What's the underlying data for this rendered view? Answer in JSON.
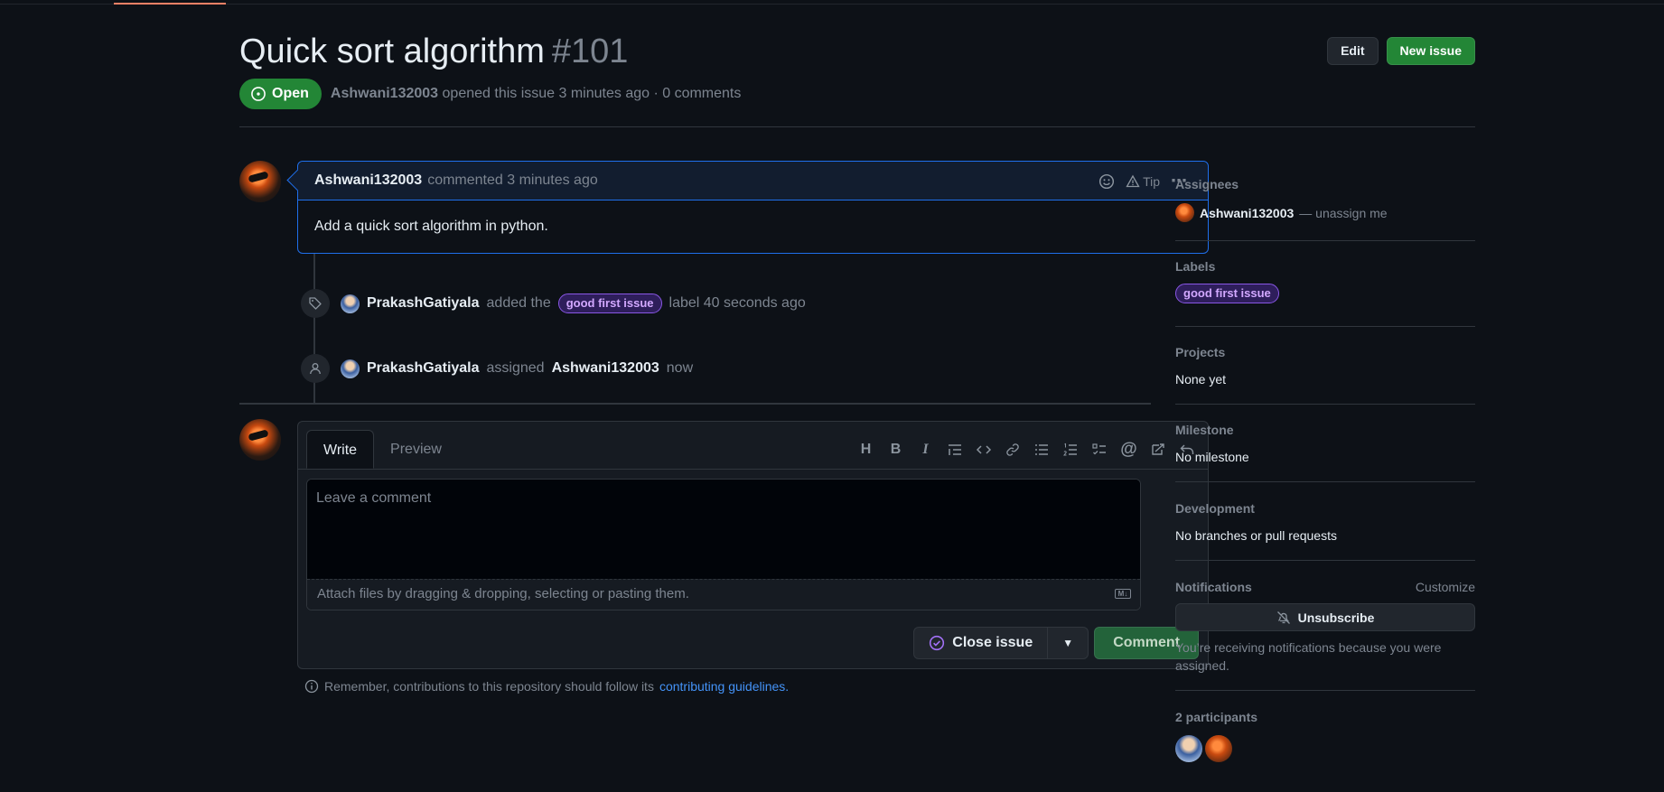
{
  "issue": {
    "title": "Quick sort algorithm",
    "number": "#101",
    "state": "Open",
    "author": "Ashwani132003",
    "opened_text": "opened this issue 3 minutes ago · 0 comments"
  },
  "header": {
    "edit_label": "Edit",
    "new_issue_label": "New issue"
  },
  "comment": {
    "author": "Ashwani132003",
    "time": "commented 3 minutes ago",
    "tip_label": "Tip",
    "body": "Add a quick sort algorithm in python."
  },
  "events": [
    {
      "actor": "PrakashGatiyala",
      "action": "added the",
      "label": "good first issue",
      "suffix": "label 40 seconds ago"
    },
    {
      "actor": "PrakashGatiyala",
      "action": "assigned",
      "target": "Ashwani132003",
      "suffix": "now"
    }
  ],
  "composer": {
    "tab_write": "Write",
    "tab_preview": "Preview",
    "toolbar": [
      "H",
      "B",
      "I",
      "quote",
      "code",
      "link",
      "bullet-list",
      "numbered-list",
      "task-list",
      "@",
      "cross-reference",
      "undo"
    ],
    "placeholder": "Leave a comment",
    "attach_text": "Attach files by dragging & dropping, selecting or pasting them.",
    "md_badge": "M↓",
    "close_label": "Close issue",
    "comment_label": "Comment"
  },
  "reminder": {
    "text": "Remember, contributions to this repository should follow its",
    "link": "contributing guidelines."
  },
  "sidebar": {
    "assignees_title": "Assignees",
    "assignee_name": "Ashwani132003",
    "unassign_text": "— unassign me",
    "labels_title": "Labels",
    "label": "good first issue",
    "projects_title": "Projects",
    "projects_value": "None yet",
    "milestone_title": "Milestone",
    "milestone_value": "No milestone",
    "development_title": "Development",
    "development_value": "No branches or pull requests",
    "notifications_title": "Notifications",
    "customize_label": "Customize",
    "unsubscribe_label": "Unsubscribe",
    "notifications_note": "You’re receiving notifications because you were assigned.",
    "participants_title": "2 participants"
  },
  "colors": {
    "background": "#0d1117",
    "open_green": "#238636",
    "accent_blue": "#1f6feb",
    "label_purple": "#d2a8ff",
    "link_blue": "#4493f8"
  }
}
